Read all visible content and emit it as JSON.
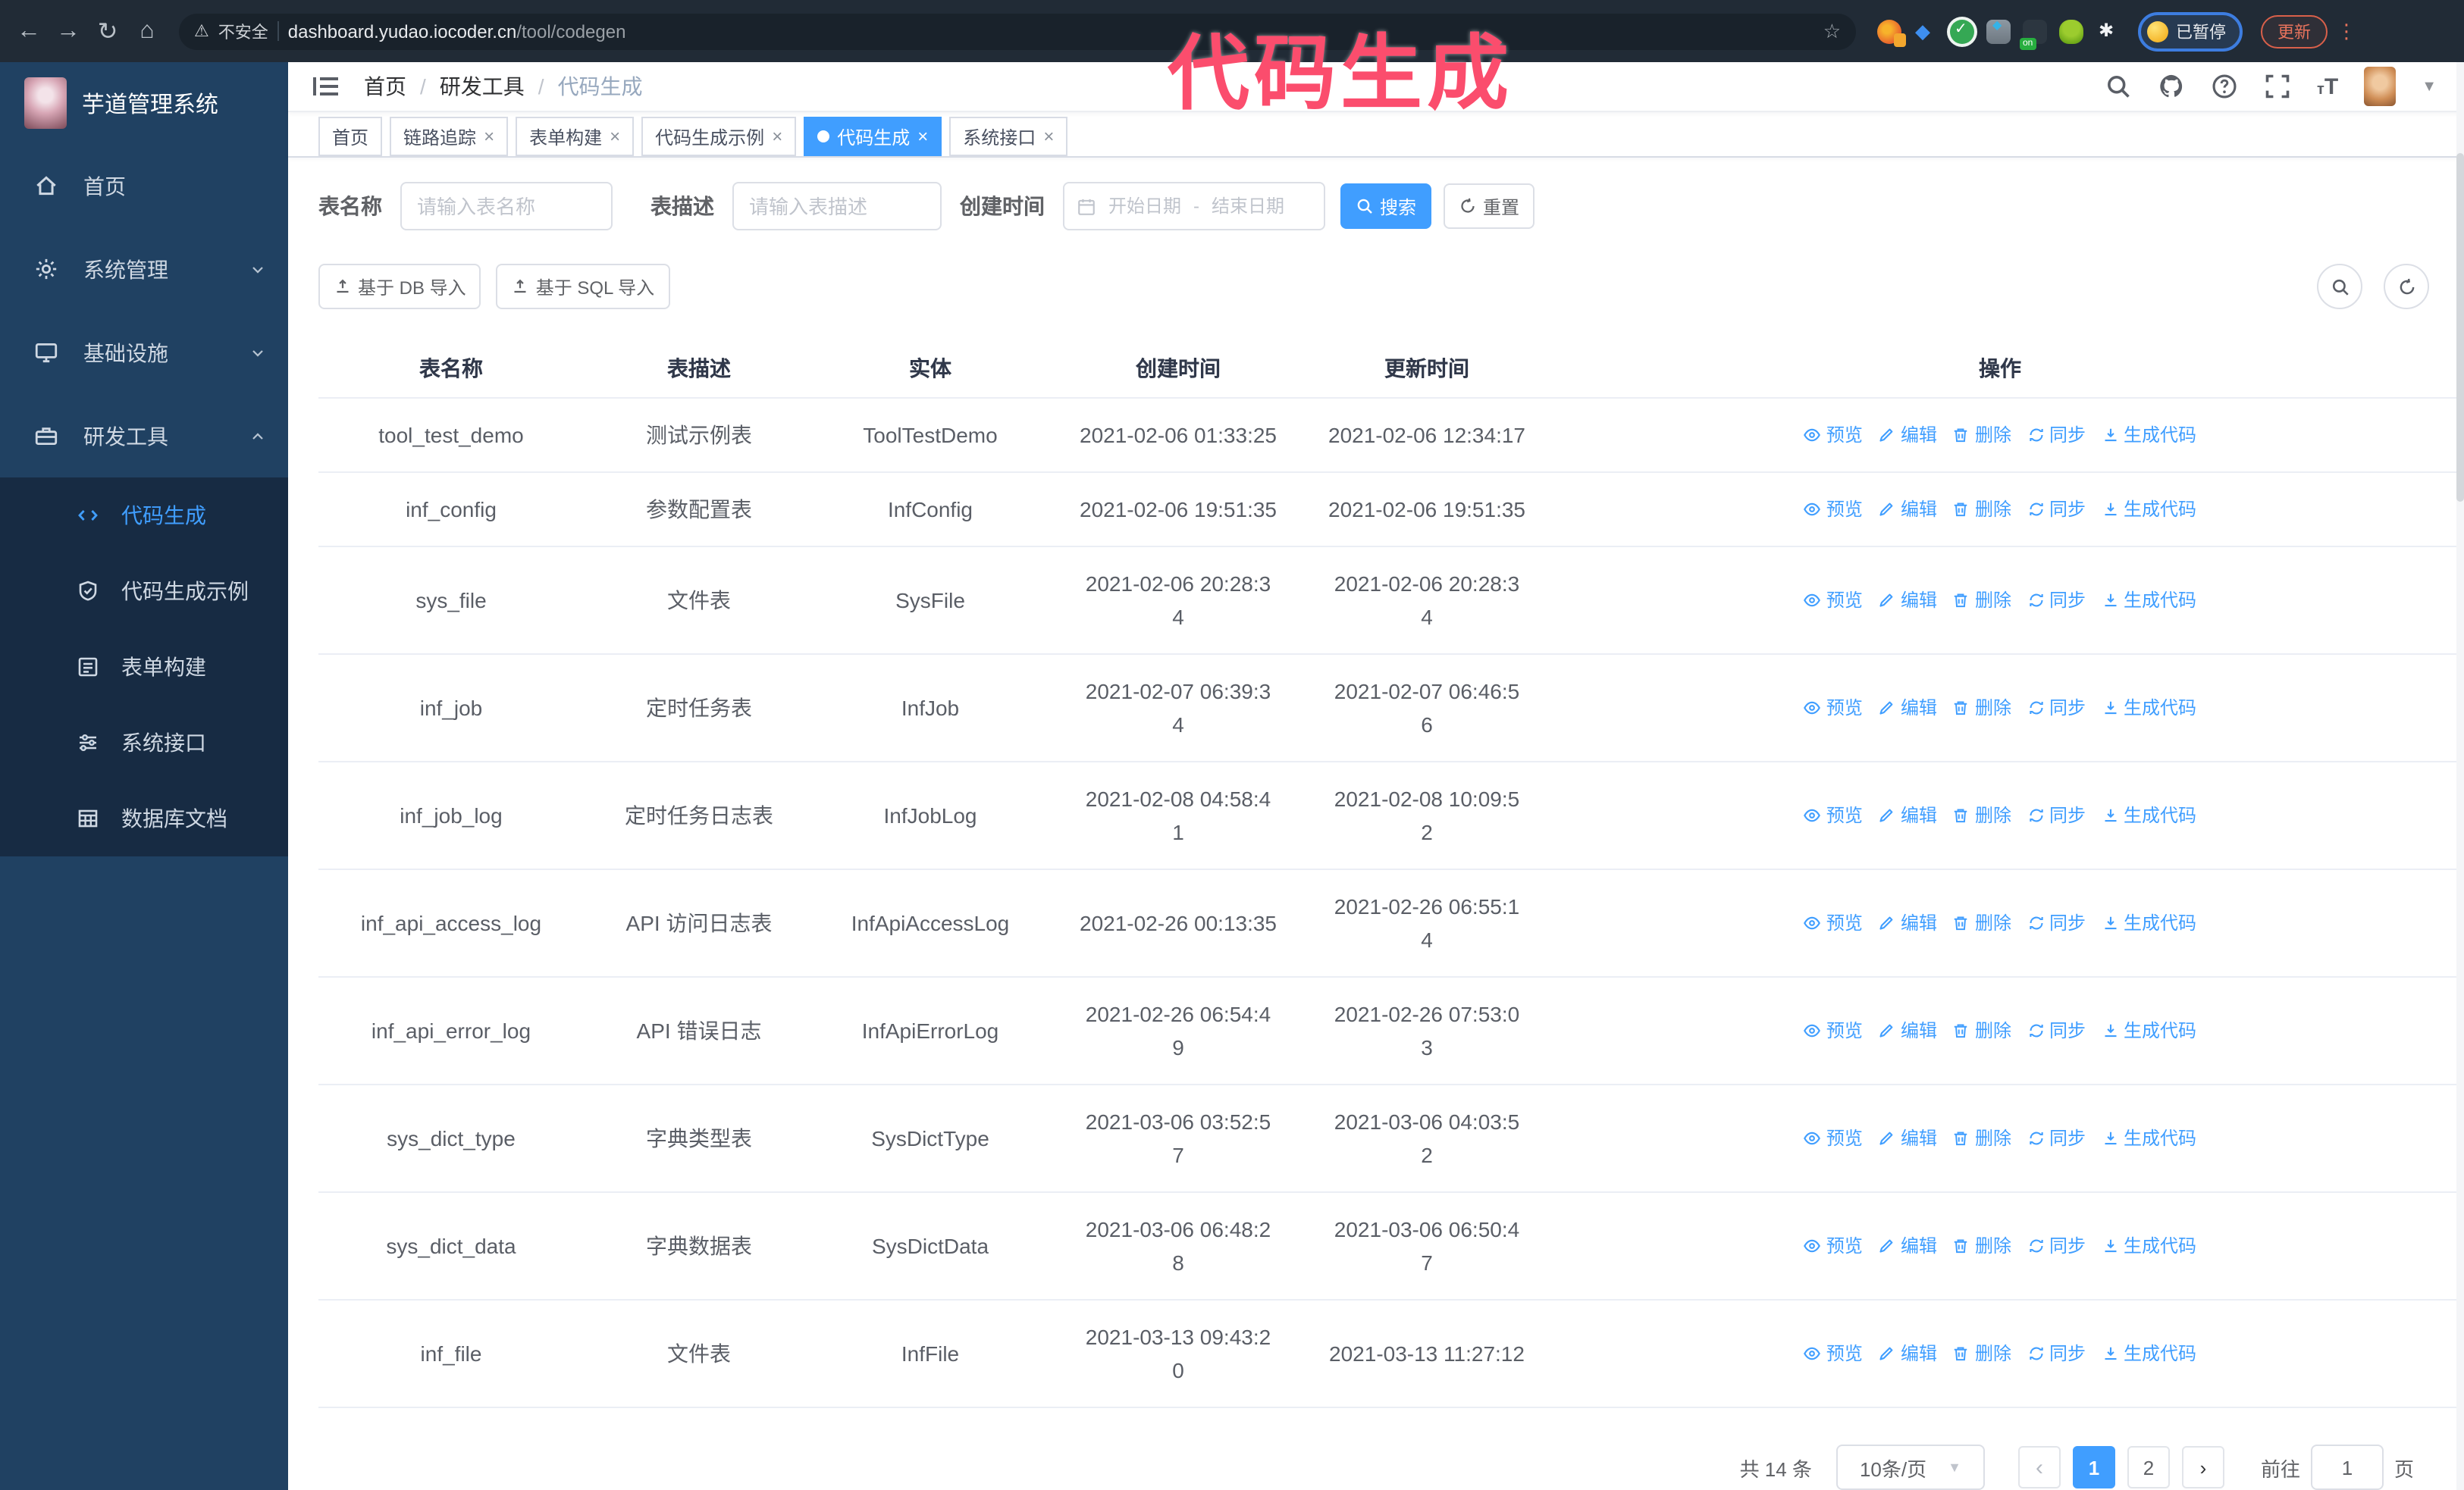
{
  "browser": {
    "security_label": "不安全",
    "url_domain": "dashboard.yudao.iocoder.cn",
    "url_path": "/tool/codegen",
    "ext_on_badge": "on",
    "profile_label": "已暂停",
    "update_label": "更新"
  },
  "annotation": {
    "text": "代码生成",
    "color": "#fb4d6d"
  },
  "sidebar": {
    "title": "芋道管理系统",
    "items": [
      {
        "label": "首页",
        "icon": "home-icon"
      },
      {
        "label": "系统管理",
        "icon": "gear-icon"
      },
      {
        "label": "基础设施",
        "icon": "infra-icon"
      },
      {
        "label": "研发工具",
        "icon": "tools-icon"
      }
    ],
    "submenu": [
      {
        "label": "代码生成",
        "icon": "code-icon",
        "active": true
      },
      {
        "label": "代码生成示例",
        "icon": "example-icon"
      },
      {
        "label": "表单构建",
        "icon": "form-icon"
      },
      {
        "label": "系统接口",
        "icon": "api-icon"
      },
      {
        "label": "数据库文档",
        "icon": "dbdoc-icon"
      }
    ]
  },
  "navbar": {
    "breadcrumb": [
      "首页",
      "研发工具",
      "代码生成"
    ]
  },
  "tabs": [
    {
      "label": "首页"
    },
    {
      "label": "链路追踪"
    },
    {
      "label": "表单构建"
    },
    {
      "label": "代码生成示例"
    },
    {
      "label": "代码生成",
      "active": true
    },
    {
      "label": "系统接口"
    }
  ],
  "filters": {
    "name_label": "表名称",
    "name_placeholder": "请输入表名称",
    "desc_label": "表描述",
    "desc_placeholder": "请输入表描述",
    "time_label": "创建时间",
    "start_placeholder": "开始日期",
    "range_separator": "-",
    "end_placeholder": "结束日期",
    "search_label": "搜索",
    "reset_label": "重置"
  },
  "toolbar": {
    "import_db_label": "基于 DB 导入",
    "import_sql_label": "基于 SQL 导入"
  },
  "table": {
    "columns": [
      "表名称",
      "表描述",
      "实体",
      "创建时间",
      "更新时间",
      "操作"
    ],
    "actions": [
      {
        "label": "预览",
        "icon": "eye-icon",
        "ref": "#i-eye"
      },
      {
        "label": "编辑",
        "icon": "edit-icon",
        "ref": "#i-edit"
      },
      {
        "label": "删除",
        "icon": "delete-icon",
        "ref": "#i-del"
      },
      {
        "label": "同步",
        "icon": "sync-icon",
        "ref": "#i-sync"
      },
      {
        "label": "生成代码",
        "icon": "generate-code-icon",
        "ref": "#i-gen"
      }
    ],
    "rows": [
      {
        "name": "tool_test_demo",
        "desc": "测试示例表",
        "entity": "ToolTestDemo",
        "created": "2021-02-06 01:33:25",
        "updated": "2021-02-06 12:34:17"
      },
      {
        "name": "inf_config",
        "desc": "参数配置表",
        "entity": "InfConfig",
        "created": "2021-02-06 19:51:35",
        "updated": "2021-02-06 19:51:35"
      },
      {
        "name": "sys_file",
        "desc": "文件表",
        "entity": "SysFile",
        "created": "2021-02-06 20:28:3\n4",
        "updated": "2021-02-06 20:28:3\n4"
      },
      {
        "name": "inf_job",
        "desc": "定时任务表",
        "entity": "InfJob",
        "created": "2021-02-07 06:39:3\n4",
        "updated": "2021-02-07 06:46:5\n6"
      },
      {
        "name": "inf_job_log",
        "desc": "定时任务日志表",
        "entity": "InfJobLog",
        "created": "2021-02-08 04:58:4\n1",
        "updated": "2021-02-08 10:09:5\n2"
      },
      {
        "name": "inf_api_access_log",
        "desc": "API 访问日志表",
        "entity": "InfApiAccessLog",
        "created": "2021-02-26 00:13:35",
        "updated": "2021-02-26 06:55:1\n4"
      },
      {
        "name": "inf_api_error_log",
        "desc": "API 错误日志",
        "entity": "InfApiErrorLog",
        "created": "2021-02-26 06:54:4\n9",
        "updated": "2021-02-26 07:53:0\n3"
      },
      {
        "name": "sys_dict_type",
        "desc": "字典类型表",
        "entity": "SysDictType",
        "created": "2021-03-06 03:52:5\n7",
        "updated": "2021-03-06 04:03:5\n2"
      },
      {
        "name": "sys_dict_data",
        "desc": "字典数据表",
        "entity": "SysDictData",
        "created": "2021-03-06 06:48:2\n8",
        "updated": "2021-03-06 06:50:4\n7"
      },
      {
        "name": "inf_file",
        "desc": "文件表",
        "entity": "InfFile",
        "created": "2021-03-13 09:43:2\n0",
        "updated": "2021-03-13 11:27:12"
      }
    ]
  },
  "pagination": {
    "total_text": "共 14 条",
    "page_size_text": "10条/页",
    "prev_label": "‹",
    "next_label": "›",
    "pages": [
      "1",
      "2"
    ],
    "active_page": "1",
    "goto_label": "前往",
    "goto_value": "1",
    "goto_suffix": "页"
  },
  "colors": {
    "accent": "#409eff",
    "sidebar_bg": "#204162",
    "submenu_bg": "#172b43",
    "annotation": "#fb4d6d",
    "chrome_bg": "#212b36"
  }
}
